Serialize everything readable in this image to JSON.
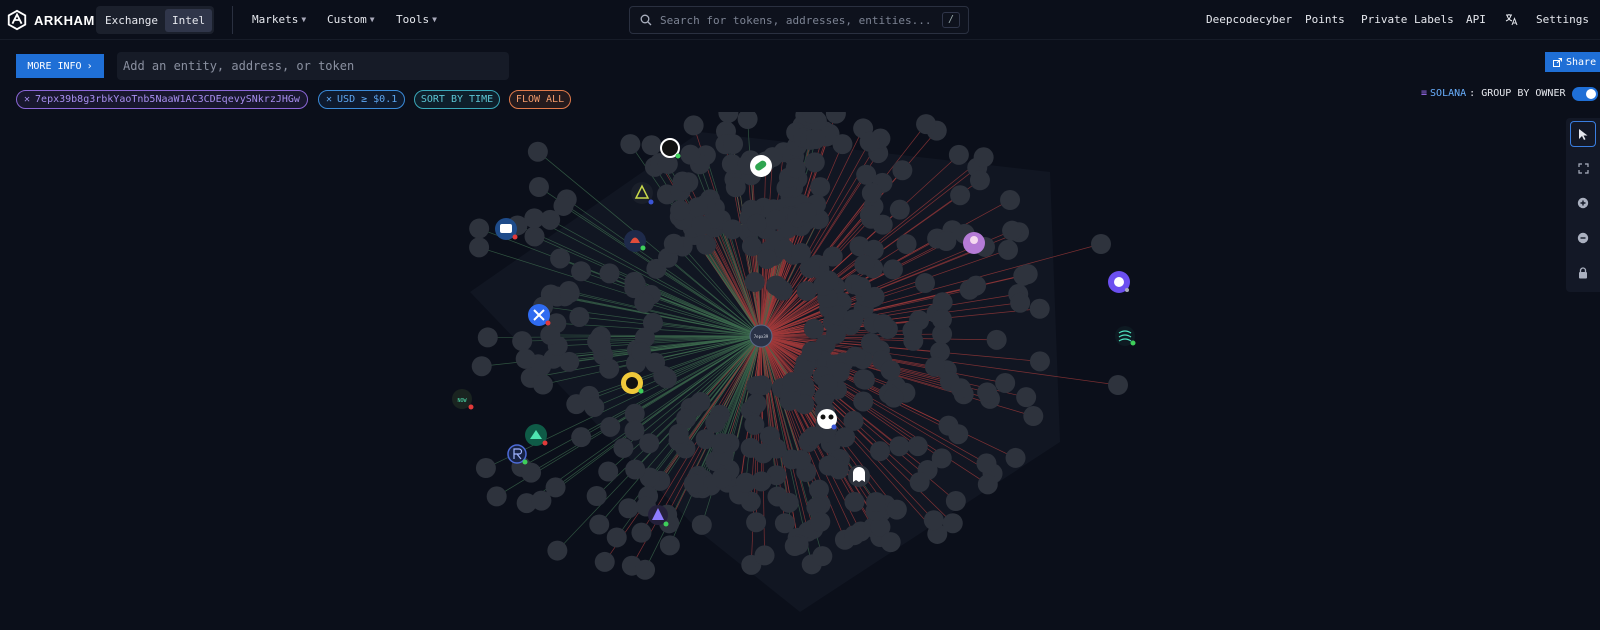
{
  "app": {
    "brand": "ARKHAM",
    "modes": [
      {
        "label": "Exchange",
        "active": false
      },
      {
        "label": "Intel",
        "active": true
      }
    ],
    "menus": [
      {
        "label": "Markets"
      },
      {
        "label": "Custom"
      },
      {
        "label": "Tools"
      }
    ],
    "search_placeholder": "Search for tokens, addresses, entities...",
    "search_shortcut": "/",
    "right_links": [
      "Deepcodecyber",
      "Points",
      "Private Labels",
      "API",
      "Settings"
    ]
  },
  "toolbar": {
    "more_info_label": "MORE INFO",
    "entity_placeholder": "Add an entity, address, or token",
    "share_label": "Share"
  },
  "filters": {
    "address": "7epx39b8g3rbkYaoTnb5NaaW1AC3CDEqevySNkrzJHGw",
    "usd": "USD ≥ $0.1",
    "sort": "SORT BY TIME",
    "flow": "FLOW ALL"
  },
  "grouping": {
    "chain": "SOLANA",
    "label": ": GROUP BY OWNER",
    "enabled": true
  },
  "graph": {
    "colors": {
      "inflow": "#3d6b4e",
      "outflow": "#a23a3a",
      "node": "#2e333d",
      "center_node": "#2a3246"
    }
  }
}
